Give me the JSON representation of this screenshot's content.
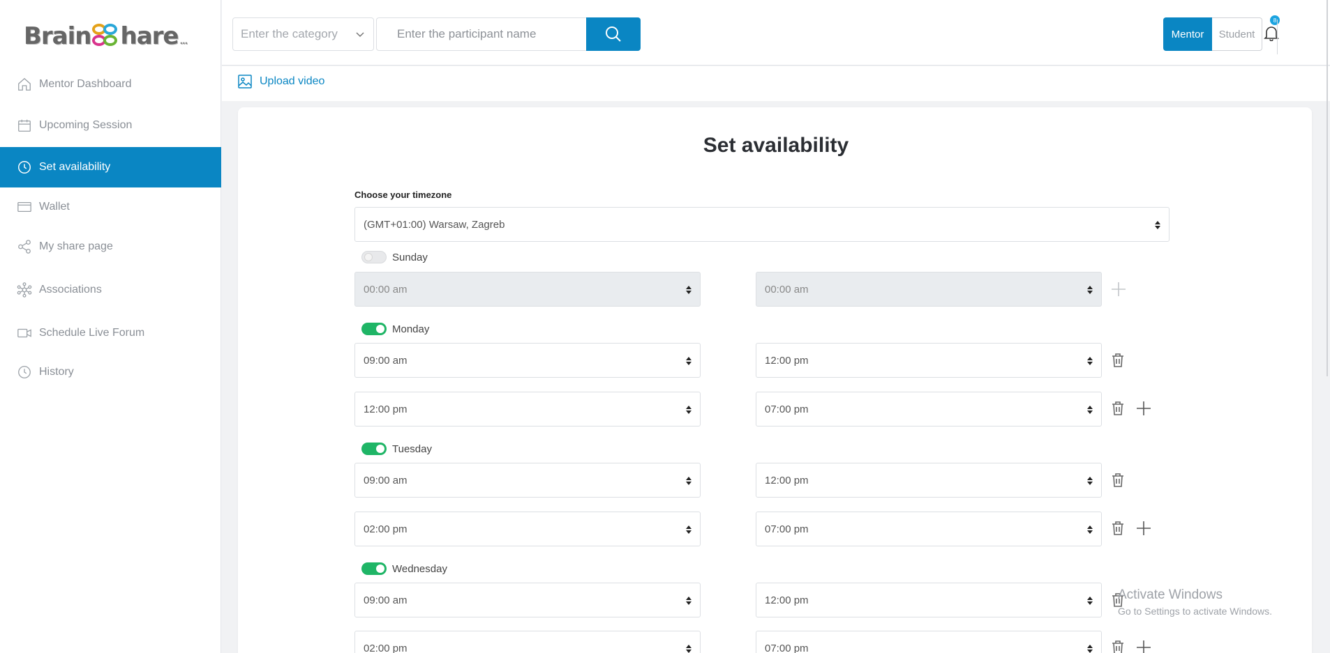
{
  "logo": {
    "left": "Brain",
    "right": "hare",
    "tail": "...",
    "s_letter": "S"
  },
  "sidebar": {
    "items": [
      {
        "label": "Mentor Dashboard",
        "icon": "home-icon"
      },
      {
        "label": "Upcoming Session",
        "icon": "calendar-icon"
      },
      {
        "label": "Set availability",
        "icon": "clock-icon",
        "active": true
      },
      {
        "label": "Wallet",
        "icon": "card-icon"
      },
      {
        "label": "My share page",
        "icon": "share-icon"
      },
      {
        "label": "Associations",
        "icon": "network-icon"
      },
      {
        "label": "Schedule Live Forum",
        "icon": "video-icon"
      },
      {
        "label": "History",
        "icon": "history-icon"
      }
    ]
  },
  "header": {
    "category_placeholder": "Enter the category",
    "participant_placeholder": "Enter the participant name",
    "role_mentor": "Mentor",
    "role_student": "Student",
    "notification_count": "8"
  },
  "upload": {
    "label": "Upload video"
  },
  "main": {
    "title": "Set availability",
    "timezone_label": "Choose your timezone",
    "timezone_value": "(GMT+01:00) Warsaw, Zagreb",
    "days": [
      {
        "name": "Sunday",
        "enabled": false,
        "slots": [
          {
            "start": "00:00 am",
            "end": "00:00 am"
          }
        ]
      },
      {
        "name": "Monday",
        "enabled": true,
        "slots": [
          {
            "start": "09:00 am",
            "end": "12:00 pm"
          },
          {
            "start": "12:00 pm",
            "end": "07:00 pm"
          }
        ]
      },
      {
        "name": "Tuesday",
        "enabled": true,
        "slots": [
          {
            "start": "09:00 am",
            "end": "12:00 pm"
          },
          {
            "start": "02:00 pm",
            "end": "07:00 pm"
          }
        ]
      },
      {
        "name": "Wednesday",
        "enabled": true,
        "slots": [
          {
            "start": "09:00 am",
            "end": "12:00 pm"
          },
          {
            "start": "02:00 pm",
            "end": "07:00 pm"
          }
        ]
      }
    ]
  },
  "watermark": {
    "line1": "Activate Windows",
    "line2": "Go to Settings to activate Windows."
  },
  "colors": {
    "accent": "#0a86c3",
    "toggle_on": "#1fb566",
    "active_nav_text": "#ffffff"
  }
}
